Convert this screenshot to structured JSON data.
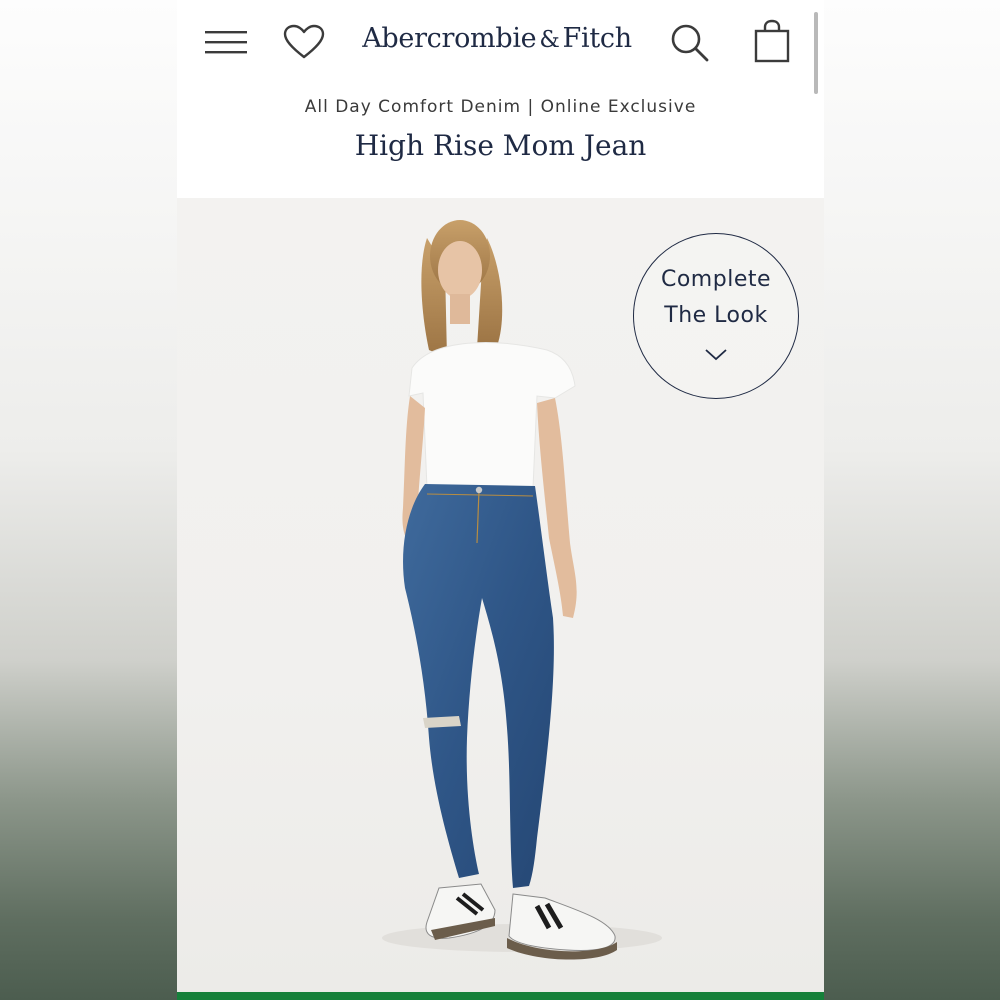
{
  "header": {
    "logo_main": "Abercrombie",
    "logo_amp": "&",
    "logo_end": "Fitch",
    "menu_icon": "hamburger-menu-icon",
    "wishlist_icon": "heart-icon",
    "search_icon": "search-icon",
    "bag_icon": "shopping-bag-icon"
  },
  "product": {
    "subtitle": "All Day Comfort Denim | Online Exclusive",
    "title": "High Rise Mom Jean"
  },
  "complete_the_look": {
    "line1": "Complete",
    "line2": "The Look",
    "icon": "chevron-down-icon"
  },
  "colors": {
    "brand_navy": "#1f2a44",
    "accent_green": "#16803a"
  }
}
